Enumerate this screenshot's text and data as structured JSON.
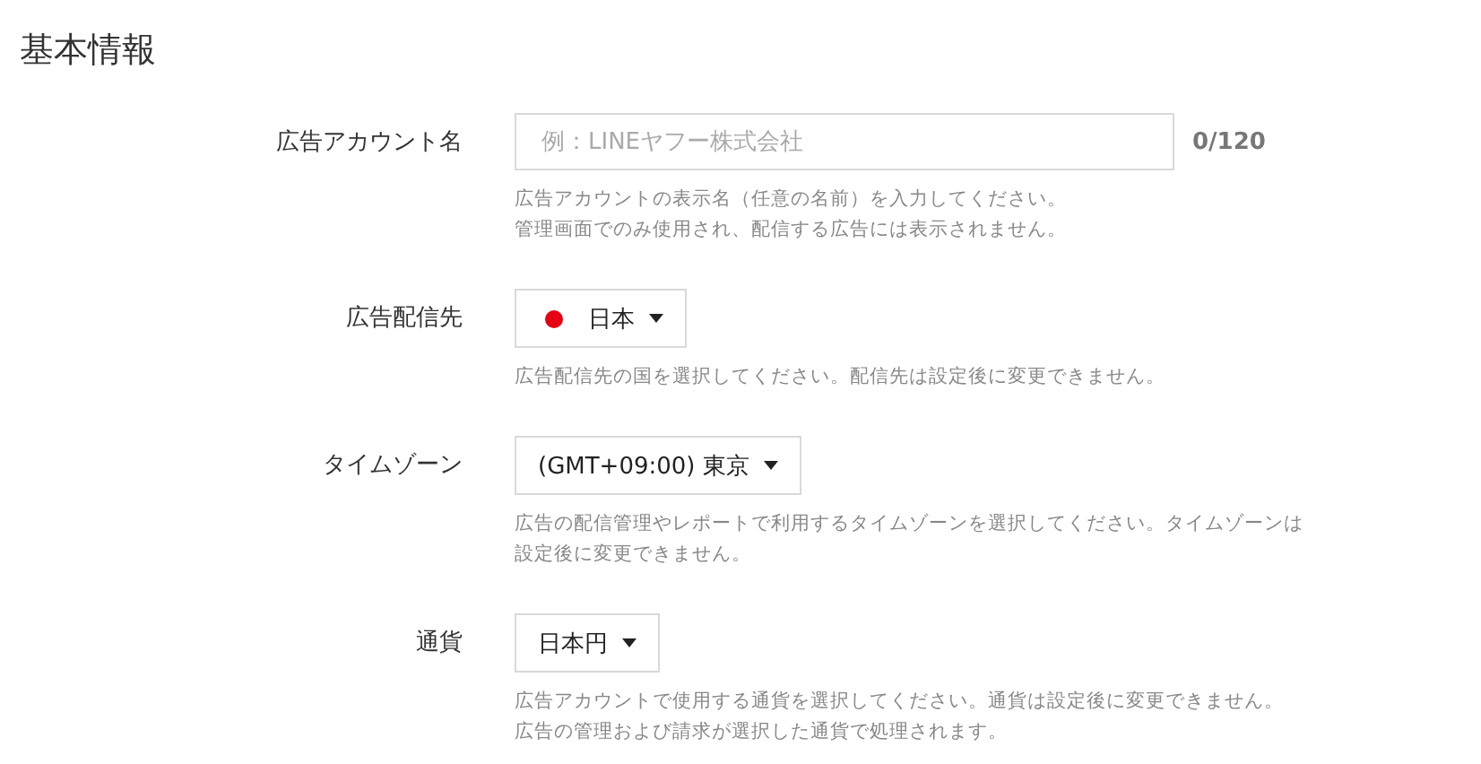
{
  "section_title": "基本情報",
  "fields": [
    {
      "kind": "text",
      "label": "広告アカウント名",
      "placeholder": "例：LINEヤフー株式会社",
      "counter": "0/120",
      "help_lines": [
        "広告アカウントの表示名（任意の名前）を入力してください。",
        "管理画面でのみ使用され、配信する広告には表示されません。"
      ]
    },
    {
      "kind": "select",
      "label": "広告配信先",
      "value": "日本",
      "color": "#e60012",
      "help_lines": [
        "広告配信先の国を選択してください。配信先は設定後に変更できません。"
      ]
    },
    {
      "kind": "select",
      "label": "タイムゾーン",
      "value": "(GMT+09:00) 東京",
      "help_lines": [
        "広告の配信管理やレポートで利用するタイムゾーンを選択してください。タイムゾーンは",
        "設定後に変更できません。"
      ]
    },
    {
      "kind": "select",
      "label": "通貨",
      "value": "日本円",
      "help_lines": [
        "広告アカウントで使用する通貨を選択してください。通貨は設定後に変更できません。",
        "広告の管理および請求が選択した通貨で処理されます。"
      ]
    }
  ]
}
